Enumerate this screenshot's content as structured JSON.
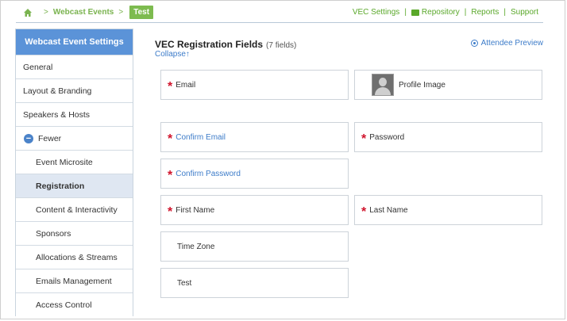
{
  "breadcrumb": {
    "home_icon": "home-icon",
    "separator": ">",
    "section": "Webcast Events",
    "current": "Test"
  },
  "toplinks": {
    "vec_settings": "VEC Settings",
    "repository": "Repository",
    "reports": "Reports",
    "support": "Support",
    "separator": "|"
  },
  "sidebar": {
    "title": "Webcast Event Settings",
    "items": [
      {
        "label": "General"
      },
      {
        "label": "Layout & Branding"
      },
      {
        "label": "Speakers & Hosts"
      },
      {
        "label": "Fewer"
      },
      {
        "label": "Event Microsite"
      },
      {
        "label": "Registration"
      },
      {
        "label": "Content & Interactivity"
      },
      {
        "label": "Sponsors"
      },
      {
        "label": "Allocations & Streams"
      },
      {
        "label": "Emails Management"
      },
      {
        "label": "Access Control"
      }
    ]
  },
  "main": {
    "title": "VEC Registration Fields",
    "count": "(7 fields)",
    "collapse": "Collapse↑",
    "preview": "Attendee Preview",
    "fields": {
      "email": "Email",
      "profile_image": "Profile Image",
      "confirm_email": "Confirm Email",
      "password": "Password",
      "confirm_password": "Confirm Password",
      "first_name": "First Name",
      "last_name": "Last Name",
      "time_zone": "Time Zone",
      "test": "Test"
    },
    "required_marker": "*"
  },
  "colors": {
    "accent_green": "#7dbb4f",
    "sidebar_header": "#5b93d8",
    "link_blue": "#3d7cc9",
    "required_red": "#d0142c"
  }
}
